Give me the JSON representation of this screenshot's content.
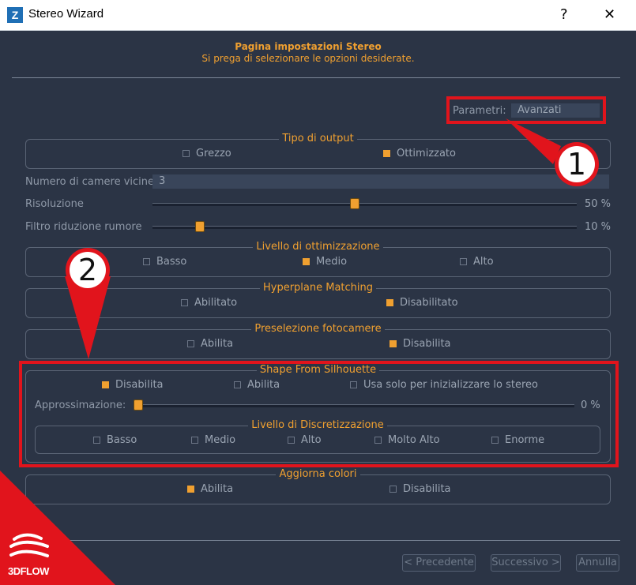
{
  "window": {
    "title": "Stereo Wizard",
    "app_icon_letter": "Z",
    "help_label": "?",
    "close_label": "✕"
  },
  "header": {
    "title": "Pagina impostazioni Stereo",
    "subtitle": "Si prega di selezionare le opzioni desiderate."
  },
  "parameters": {
    "label": "Parametri:",
    "value": "Avanzati"
  },
  "output_type": {
    "title": "Tipo di output",
    "options": [
      {
        "label": "Grezzo",
        "checked": false
      },
      {
        "label": "Ottimizzato",
        "checked": true
      }
    ]
  },
  "nearby_cameras": {
    "label": "Numero di camere vicine",
    "value": "3"
  },
  "resolution": {
    "label": "Risoluzione",
    "percent_text": "50 %",
    "value": 0.5
  },
  "noise_filter": {
    "label": "Filtro riduzione rumore",
    "percent_text": "10 %",
    "value": 0.1
  },
  "optimization": {
    "title": "Livello di ottimizzazione",
    "options": [
      {
        "label": "Basso",
        "checked": false
      },
      {
        "label": "Medio",
        "checked": true
      },
      {
        "label": "Alto",
        "checked": false
      }
    ]
  },
  "hyperplane": {
    "title": "Hyperplane Matching",
    "options": [
      {
        "label": "Abilitato",
        "checked": false
      },
      {
        "label": "Disabilitato",
        "checked": true
      }
    ]
  },
  "preselection": {
    "title": "Preselezione fotocamere",
    "options": [
      {
        "label": "Abilita",
        "checked": false
      },
      {
        "label": "Disabilita",
        "checked": true
      }
    ]
  },
  "silhouette": {
    "title": "Shape From Silhouette",
    "options": [
      {
        "label": "Disabilita",
        "checked": true
      },
      {
        "label": "Abilita",
        "checked": false
      },
      {
        "label": "Usa solo per inizializzare lo stereo",
        "checked": false
      }
    ],
    "approx_label": "Approssimazione:",
    "approx_percent_text": "0 %",
    "approx_value": 0.0,
    "discretization": {
      "title": "Livello di Discretizzazione",
      "options": [
        {
          "label": "Basso",
          "checked": false
        },
        {
          "label": "Medio",
          "checked": false
        },
        {
          "label": "Alto",
          "checked": false
        },
        {
          "label": "Molto Alto",
          "checked": false
        },
        {
          "label": "Enorme",
          "checked": false
        }
      ]
    }
  },
  "update_colors": {
    "title": "Aggiorna colori",
    "options": [
      {
        "label": "Abilita",
        "checked": true
      },
      {
        "label": "Disabilita",
        "checked": false
      }
    ]
  },
  "footer": {
    "back": "< Precedente",
    "next": "Successivo >",
    "cancel": "Annulla"
  },
  "annotations": {
    "callout_1": "1",
    "callout_2": "2",
    "highlight_color": "#e1141c"
  },
  "brand": {
    "name": "3DFLOW"
  },
  "colors": {
    "accent": "#f0a030",
    "background": "#2b3445",
    "text": "#9aa4b2"
  }
}
